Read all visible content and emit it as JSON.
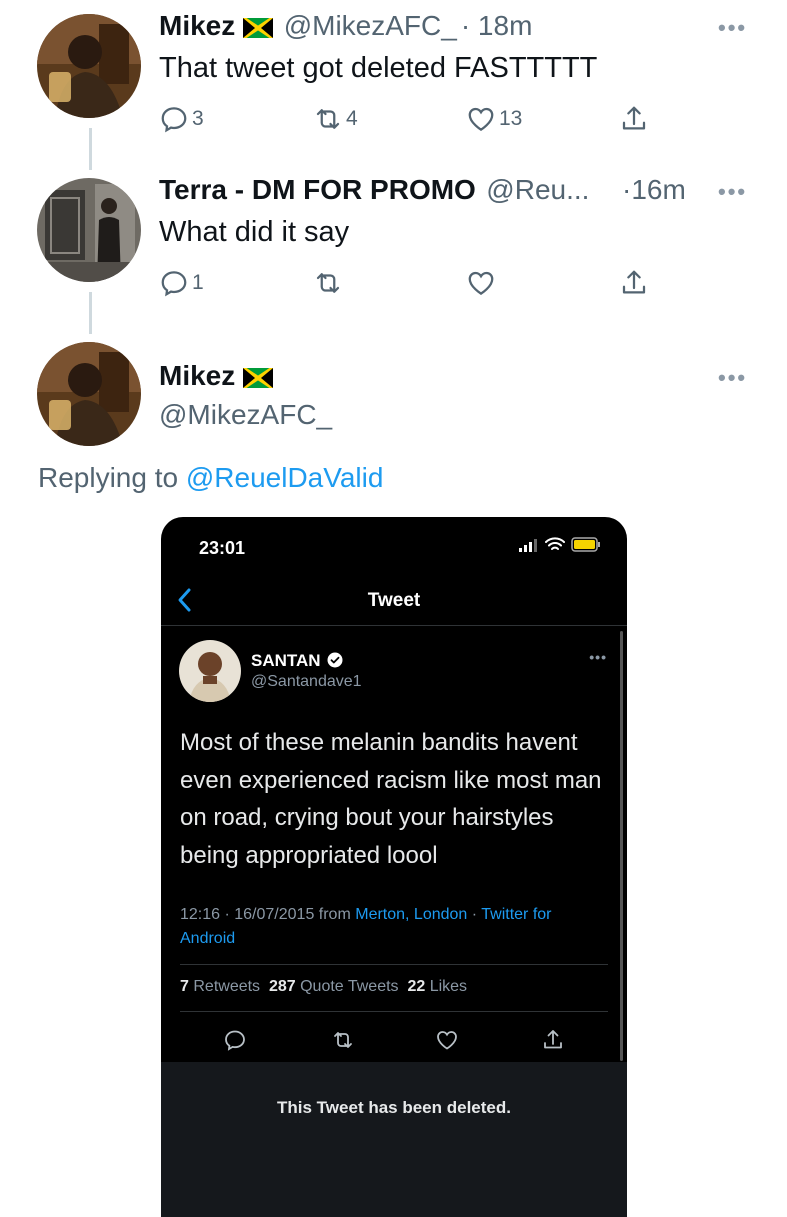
{
  "tweets": [
    {
      "name": "Mikez",
      "handle": "@MikezAFC_",
      "time": "· 18m",
      "text": "That tweet got deleted FASTTTTT",
      "replies": "3",
      "retweets": "4",
      "likes": "13"
    },
    {
      "name": "Terra - DM FOR PROMO",
      "handle": "@Reu...",
      "time": "·16m",
      "text": "What did it say",
      "replies": "1",
      "retweets": "",
      "likes": ""
    }
  ],
  "main_tweet": {
    "name": "Mikez",
    "handle": "@MikezAFC_",
    "replying_prefix": "Replying to",
    "replying_to": "@ReuelDaValid"
  },
  "embedded": {
    "status_time": "23:01",
    "header_title": "Tweet",
    "author_name": "SANTAN",
    "author_handle": "@Santandave1",
    "text": "Most of these melanin bandits havent even experienced racism like most man on road, crying bout your hairstyles being appropriated loool",
    "meta_time": "12:16 · 16/07/2015 from",
    "meta_location": "Merton, London",
    "meta_sep": " · ",
    "meta_source": "Twitter for Android",
    "retweets_count": "7",
    "retweets_label": "Retweets",
    "quotes_count": "287",
    "quotes_label": "Quote Tweets",
    "likes_count": "22",
    "likes_label": "Likes",
    "deleted_notice": "This Tweet has been deleted."
  },
  "icons": {
    "reply": "reply-icon",
    "retweet": "retweet-icon",
    "like": "heart-icon",
    "share": "share-icon",
    "more": "more-icon",
    "flag": "jamaica-flag-icon",
    "verified": "verified-badge-icon"
  },
  "colors": {
    "accent": "#1d9bf0",
    "secondary_text": "#536471",
    "thread_line": "#cfd9de"
  }
}
